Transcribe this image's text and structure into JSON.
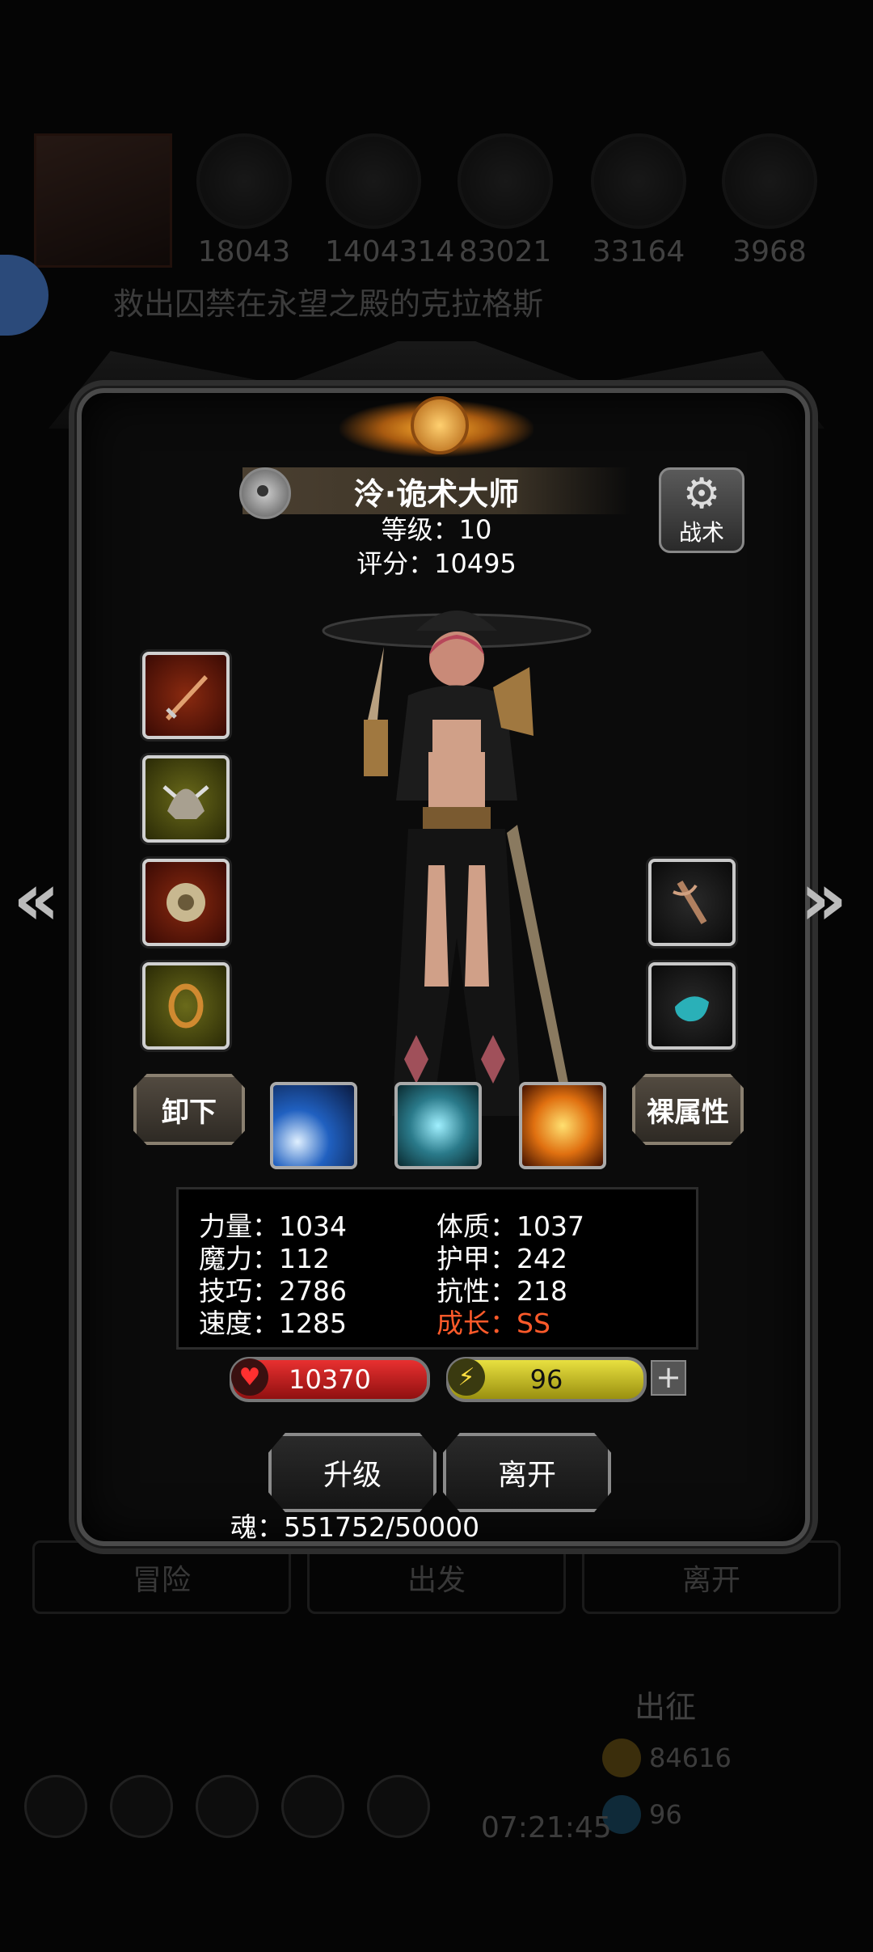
{
  "background": {
    "resources": [
      "18043",
      "1404314",
      "83021",
      "33164",
      "3968"
    ],
    "quest_text": "救出囚禁在永望之殿的克拉格斯",
    "tabs": [
      "冒险",
      "出发",
      "离开"
    ],
    "dispatch_label": "出征",
    "currency_1": "84616",
    "currency_2": "96",
    "clock": "07:21:45"
  },
  "hero": {
    "name": "泠·诡术大师",
    "level": "等级：10",
    "score": "评分：10495",
    "tactic_label": "战术"
  },
  "buttons": {
    "unequip": "卸下",
    "base_attr": "裸属性",
    "upgrade": "升级",
    "leave": "离开"
  },
  "stats": {
    "strength": "力量：1034",
    "magic": "魔力：112",
    "skill": "技巧：2786",
    "speed": "速度：1285",
    "constitution": "体质：1037",
    "armor": "护甲：242",
    "resistance": "抗性：218",
    "growth": "成长：SS"
  },
  "bars": {
    "hp": "10370",
    "energy": "96"
  },
  "soul": "魂：551752/50000",
  "colors": {
    "hp": "#c81414",
    "energy": "#d4c418",
    "growth": "#ff5a2a",
    "panel": "#0b0b0b"
  }
}
